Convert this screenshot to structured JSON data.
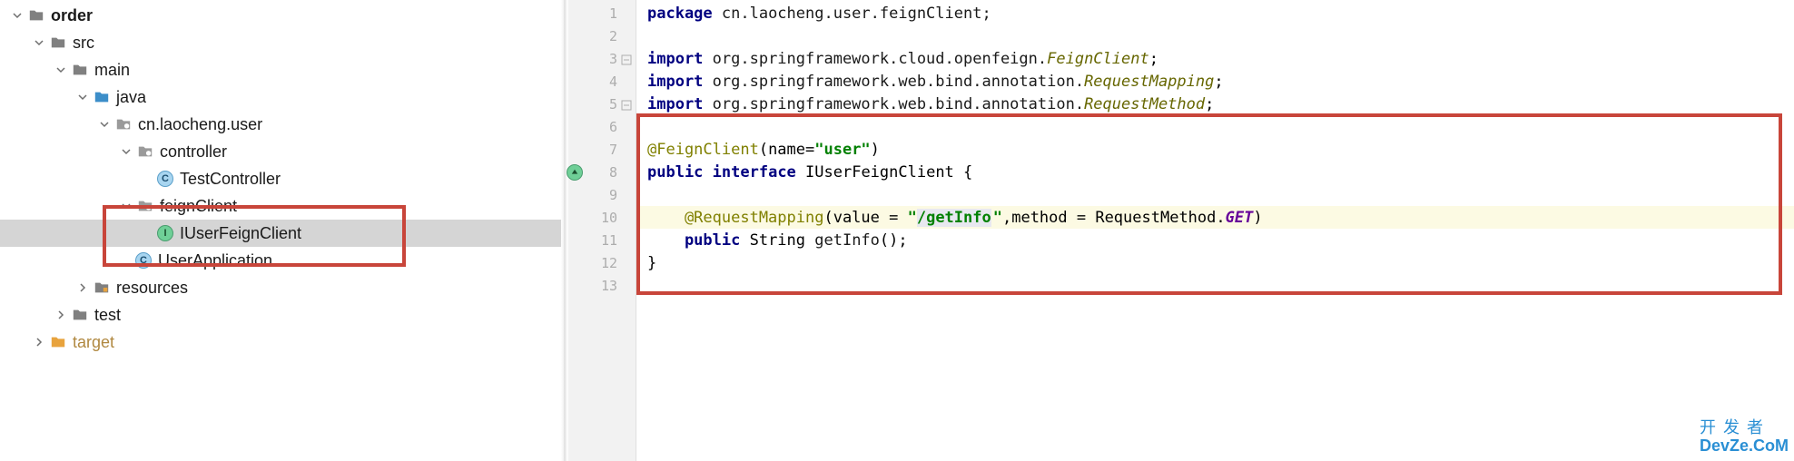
{
  "tree": {
    "root": "order",
    "src": "src",
    "main": "main",
    "java": "java",
    "pkg": "cn.laocheng.user",
    "controller": "controller",
    "testController": "TestController",
    "feignClient": "feignClient",
    "iUserFeignClient": "IUserFeignClient",
    "userApplication": "UserApplication",
    "resources": "resources",
    "test": "test",
    "target": "target"
  },
  "code": {
    "lines": [
      "1",
      "2",
      "3",
      "4",
      "5",
      "6",
      "7",
      "8",
      "9",
      "10",
      "11",
      "12",
      "13"
    ],
    "l1_kw": "package",
    "l1_rest": " cn.laocheng.user.feignClient;",
    "l3_kw": "import",
    "l3_mid": " org.springframework.cloud.openfeign.",
    "l3_cls": "FeignClient",
    "l3_end": ";",
    "l4_kw": "import",
    "l4_mid": " org.springframework.web.bind.annotation.",
    "l4_cls": "RequestMapping",
    "l4_end": ";",
    "l5_kw": "import",
    "l5_mid": " org.springframework.web.bind.annotation.",
    "l5_cls": "RequestMethod",
    "l5_end": ";",
    "l7_anno": "@FeignClient",
    "l7_open": "(name=",
    "l7_str": "\"user\"",
    "l7_close": ")",
    "l8_kw1": "public",
    "l8_kw2": "interface",
    "l8_name": " IUserFeignClient {",
    "l10_anno": "    @RequestMapping",
    "l10_open": "(value = ",
    "l10_str1": "\"",
    "l10_str2": "/getInfo",
    "l10_str3": "\"",
    "l10_mid": ",method = RequestMethod.",
    "l10_const": "GET",
    "l10_close": ")",
    "l11_kw": "    public",
    "l11_type": " String ",
    "l11_method": "getInfo",
    "l11_end": "();",
    "l12": "}"
  },
  "watermark": {
    "cn": "开发者",
    "en": "DevZe.CoM",
    "sub": ""
  }
}
